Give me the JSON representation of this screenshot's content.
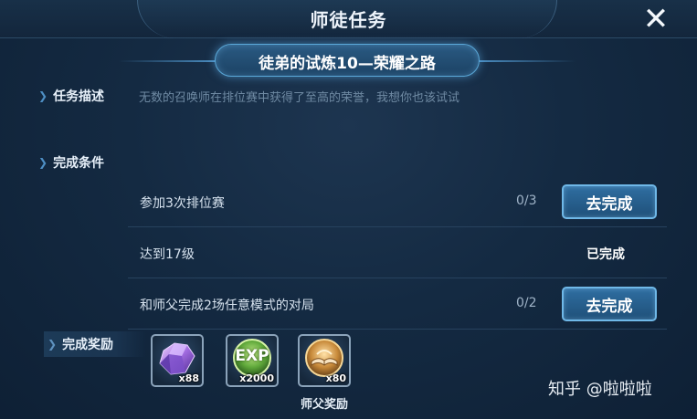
{
  "window": {
    "title": "师徒任务",
    "close_glyph": "✕"
  },
  "subtitle": "徒弟的试炼10—荣耀之路",
  "sections": {
    "description_label": "任务描述",
    "description_text": "无数的召唤师在排位赛中获得了至高的荣誉，我想你也该试试",
    "conditions_label": "完成条件",
    "rewards_label": "完成奖励"
  },
  "tasks": [
    {
      "text": "参加3次排位赛",
      "progress": "0/3",
      "action": "去完成"
    },
    {
      "text": "达到17级",
      "status": "已完成"
    },
    {
      "text": "和师父完成2场任意模式的对局",
      "progress": "0/2",
      "action": "去完成"
    }
  ],
  "rewards": [
    {
      "icon": "purple-diamond-icon",
      "count": "x88"
    },
    {
      "icon": "exp-card-icon",
      "icon_text": "EXP",
      "count": "x2000"
    },
    {
      "icon": "master-book-medal-icon",
      "count": "x80"
    }
  ],
  "reward_caption": "师父奖励",
  "watermark": "知乎 @啦啦啦",
  "colors": {
    "background": "#142a42",
    "button_fill": "#2f6ea1",
    "button_border": "#6fb8e8",
    "accent_glow": "#5aa8d8"
  }
}
